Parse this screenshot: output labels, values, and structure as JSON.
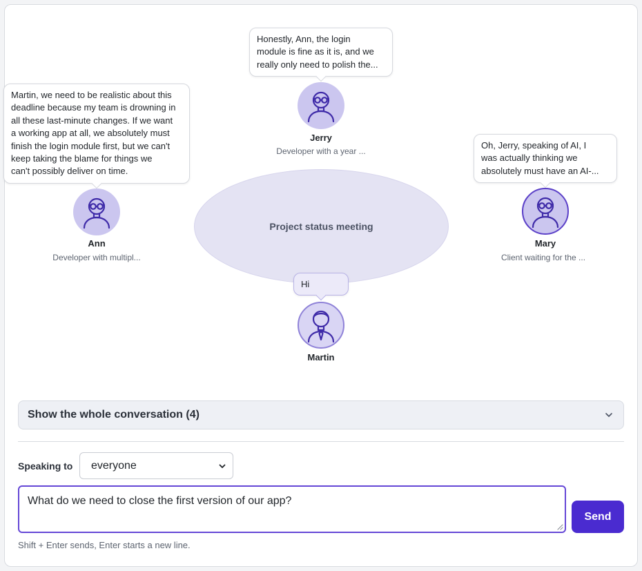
{
  "meeting": {
    "title": "Project status meeting"
  },
  "participants": {
    "jerry": {
      "name": "Jerry",
      "role": "Developer with a year ...",
      "bubble_lines": [
        "Honestly, Ann, the login",
        "module is fine as it is, and we",
        "really only need to polish the..."
      ]
    },
    "ann": {
      "name": "Ann",
      "role": "Developer with multipl...",
      "bubble_lines": [
        "Martin, we need to be realistic about this",
        "deadline because my team is drowning in",
        "all these last-minute changes. If we want",
        "a working app at all, we absolutely must",
        "finish the login module first, but we can't",
        "keep taking the blame for things we",
        "can't possibly deliver on time."
      ]
    },
    "mary": {
      "name": "Mary",
      "role": "Client waiting for the ...",
      "bubble_lines": [
        "Oh, Jerry, speaking of AI, I",
        "was actually thinking we",
        "absolutely must have an AI-..."
      ]
    },
    "martin": {
      "name": "Martin",
      "bubble_lines": [
        "Hi"
      ]
    }
  },
  "conversation_toggle": {
    "label": "Show the whole conversation (4)",
    "icon": "chevron-down-icon"
  },
  "composer": {
    "speaking_to_label": "Speaking to",
    "recipient_selected": "everyone",
    "message": "What do we need to close the first version of our app?",
    "send_label": "Send",
    "hint": "Shift + Enter sends, Enter starts a new line."
  },
  "colors": {
    "accent": "#4a2bd0",
    "avatar_fill": "#cbc6ef",
    "avatar_stroke": "#3e2aa8",
    "table_fill": "#e4e3f3"
  }
}
